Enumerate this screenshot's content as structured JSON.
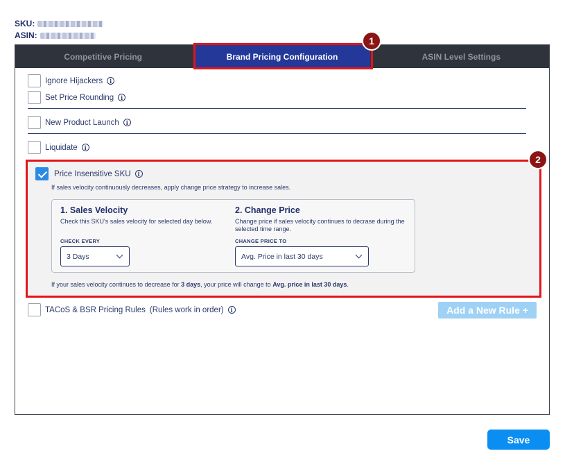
{
  "meta": {
    "sku_label": "SKU:",
    "asin_label": "ASIN:"
  },
  "tabs": [
    {
      "label": "Competitive Pricing"
    },
    {
      "label": "Brand Pricing Configuration"
    },
    {
      "label": "ASIN Level Settings"
    }
  ],
  "active_tab": "Brand Pricing Configuration",
  "badges": [
    "1",
    "2"
  ],
  "options": {
    "ignore_hijackers": {
      "label": "Ignore Hijackers",
      "checked": false
    },
    "set_price_rounding": {
      "label": "Set Price Rounding",
      "checked": false
    },
    "new_product_launch": {
      "label": "New Product Launch",
      "checked": false
    },
    "liquidate": {
      "label": "Liquidate",
      "checked": false
    },
    "price_insensitive": {
      "label": "Price Insensitive SKU",
      "checked": true
    },
    "tacos_bsr": {
      "label": "TACoS & BSR Pricing Rules",
      "note": "(Rules work in order)",
      "checked": false
    }
  },
  "info_icon": "i",
  "price_insensitive": {
    "subtitle": "If sales velocity continuously decreases, apply change price strategy to increase sales.",
    "sales_velocity": {
      "title": "1. Sales Velocity",
      "desc": "Check this SKU's sales velocity for selected day below.",
      "field_label": "CHECK EVERY",
      "value": "3 Days"
    },
    "change_price": {
      "title": "2. Change Price",
      "desc": "Change price if sales velocity continues to decrase during the selected time range.",
      "field_label": "CHANGE PRICE TO",
      "value": "Avg. Price in last 30 days"
    },
    "summary": {
      "part1": "If your sales velocity continues to decrease for ",
      "days": "3 days",
      "part2": ", your price will change to ",
      "price": "Avg. price in last 30 days",
      "part3": "."
    }
  },
  "add_rule_label": "Add a New Rule +",
  "save_label": "Save",
  "colors": {
    "accent": "#0a8ef2",
    "active_tab": "#24389a",
    "highlight": "#e3141a",
    "tab_bar": "#2f343c"
  }
}
